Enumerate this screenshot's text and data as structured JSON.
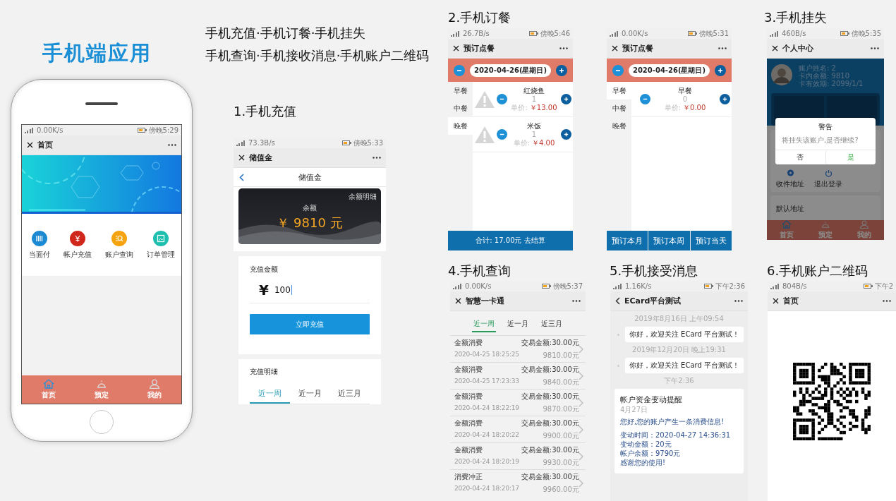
{
  "title": "手机端应用",
  "summary": [
    "手机充值·手机订餐·手机挂失",
    "手机查询·手机接收消息·手机账户二维码"
  ],
  "home_phone": {
    "status": {
      "speed": "0.00K/s",
      "time": "傍晚5:29"
    },
    "window_title": "首页",
    "features": [
      {
        "label": "当面付",
        "color": "#1b8ad3"
      },
      {
        "label": "帐户充值",
        "color": "#d0261b"
      },
      {
        "label": "账户查询",
        "color": "#f5a30f"
      },
      {
        "label": "订单管理",
        "color": "#1fbfb0"
      }
    ],
    "tabs": [
      {
        "label": "首页",
        "selected": true
      },
      {
        "label": "预定",
        "selected": false
      },
      {
        "label": "我的",
        "selected": false
      }
    ]
  },
  "recharge": {
    "heading": "1.手机充值",
    "status": {
      "speed": "73.3B/s",
      "time": "傍晚5:33"
    },
    "window_title": "储值金",
    "page_title": "储值金",
    "detail_link": "余额明细",
    "balance_label": "余额",
    "balance": "￥ 9810 元",
    "amount_label": "充值金额",
    "currency": "¥",
    "amount": "100",
    "submit": "立即充值",
    "history_title": "充值明细",
    "tabs": [
      {
        "label": "近一周",
        "selected": true
      },
      {
        "label": "近一月",
        "selected": false
      },
      {
        "label": "近三月",
        "selected": false
      }
    ]
  },
  "ordering": {
    "heading": "2.手机订餐",
    "screens": [
      {
        "status": {
          "speed": "26.7B/s",
          "time": "傍晚5:46"
        },
        "window_title": "预订点餐",
        "date": "2020-04-26(星期日)",
        "meals": [
          {
            "label": "早餐",
            "selected": false
          },
          {
            "label": "中餐",
            "selected": false
          },
          {
            "label": "晚餐",
            "selected": true
          }
        ],
        "dishes": [
          {
            "name": "红烧鱼",
            "quantity": "1",
            "price_label": "单价:",
            "price": "￥13.00",
            "has_image": true
          },
          {
            "name": "米饭",
            "quantity": "1",
            "price_label": "单价:",
            "price": "￥4.00",
            "has_image": true
          }
        ],
        "footer": [
          "合计: 17.00元 去结算"
        ]
      },
      {
        "status": {
          "speed": "0.00K/s",
          "time": "傍晚5:31"
        },
        "window_title": "预订点餐",
        "date": "2020-04-26(星期日)",
        "meals": [
          {
            "label": "早餐",
            "selected": true
          },
          {
            "label": "中餐",
            "selected": false
          },
          {
            "label": "晚餐",
            "selected": false
          }
        ],
        "dishes": [
          {
            "name": "早餐",
            "quantity": "0",
            "price_label": "单价:",
            "price": "￥0.00",
            "has_image": false
          }
        ],
        "footer": [
          "预订本月",
          "预订本周",
          "预订当天"
        ]
      }
    ]
  },
  "loss": {
    "heading": "3.手机挂失",
    "status": {
      "speed": "460B/s",
      "time": "傍晚5:35"
    },
    "window_title": "个人中心",
    "profile": [
      "账户姓名: 2",
      "卡内余额: 9810",
      "卡有效期: 2099/1/1"
    ],
    "shortcuts": [
      "收件地址",
      "退出登录"
    ],
    "address_title": "默认地址",
    "dialog": {
      "title": "警告",
      "message": "将挂失该账户,是否继续?",
      "buttons": [
        "否",
        "是"
      ]
    },
    "tabs": [
      {
        "label": "首页",
        "selected": true
      },
      {
        "label": "预定",
        "selected": false
      },
      {
        "label": "我的",
        "selected": false
      }
    ]
  },
  "query": {
    "heading": "4.手机查询",
    "status": {
      "speed": "0.00K/s",
      "time": "傍晚5:37"
    },
    "window_title": "智慧一卡通",
    "tabs": [
      {
        "label": "近一周",
        "selected": true
      },
      {
        "label": "近一月",
        "selected": false
      },
      {
        "label": "近三月",
        "selected": false
      }
    ],
    "records": [
      {
        "type": "金额消费",
        "amount": "交易金额:30.00元",
        "time": "2020-04-25 18:25:25",
        "balance": "9810.00元"
      },
      {
        "type": "金额消费",
        "amount": "交易金额:30.00元",
        "time": "2020-04-25 17:23:33",
        "balance": "9840.00元"
      },
      {
        "type": "金额消费",
        "amount": "交易金额:30.00元",
        "time": "2020-04-24 18:22:19",
        "balance": "9870.00元"
      },
      {
        "type": "金额消费",
        "amount": "交易金额:30.00元",
        "time": "2020-04-24 18:20:22",
        "balance": "9900.00元"
      },
      {
        "type": "金额消费",
        "amount": "交易金额:30.00元",
        "time": "2020-04-24 18:20:19",
        "balance": "9930.00元"
      },
      {
        "type": "消费冲正",
        "amount": "交易金额:30.00元",
        "time": "2020-04-24 18:20:17",
        "balance": "9960.00元"
      }
    ]
  },
  "messages": {
    "heading": "5.手机接受消息",
    "status": {
      "speed": "1.16K/s",
      "time": "下午2:36"
    },
    "window_title": "ECard平台测试",
    "items": [
      {
        "kind": "timestamp",
        "text": "2019年8月16日 上午09:54"
      },
      {
        "kind": "bubble",
        "text": "你好，欢迎关注 ECard 平台测试！"
      },
      {
        "kind": "timestamp",
        "text": "2019年12月20日 晚上19:31"
      },
      {
        "kind": "bubble",
        "text": "你好，欢迎关注 ECard 平台测试！"
      },
      {
        "kind": "timestamp",
        "text": "下午2:36"
      },
      {
        "kind": "card",
        "title": "帐户资金变动提醒",
        "date": "4月27日",
        "intro": "您好,您的账户产生一条消费信息!",
        "lines": [
          "变动时间：2020-04-27 14:36:31",
          "变动金额：20元",
          "帐户余额：9790元"
        ],
        "footer": "感谢您的使用!"
      }
    ]
  },
  "qr": {
    "heading": "6.手机账户二维码",
    "status": {
      "speed": "804B/s",
      "time": "下午2"
    },
    "window_title": "首页"
  }
}
